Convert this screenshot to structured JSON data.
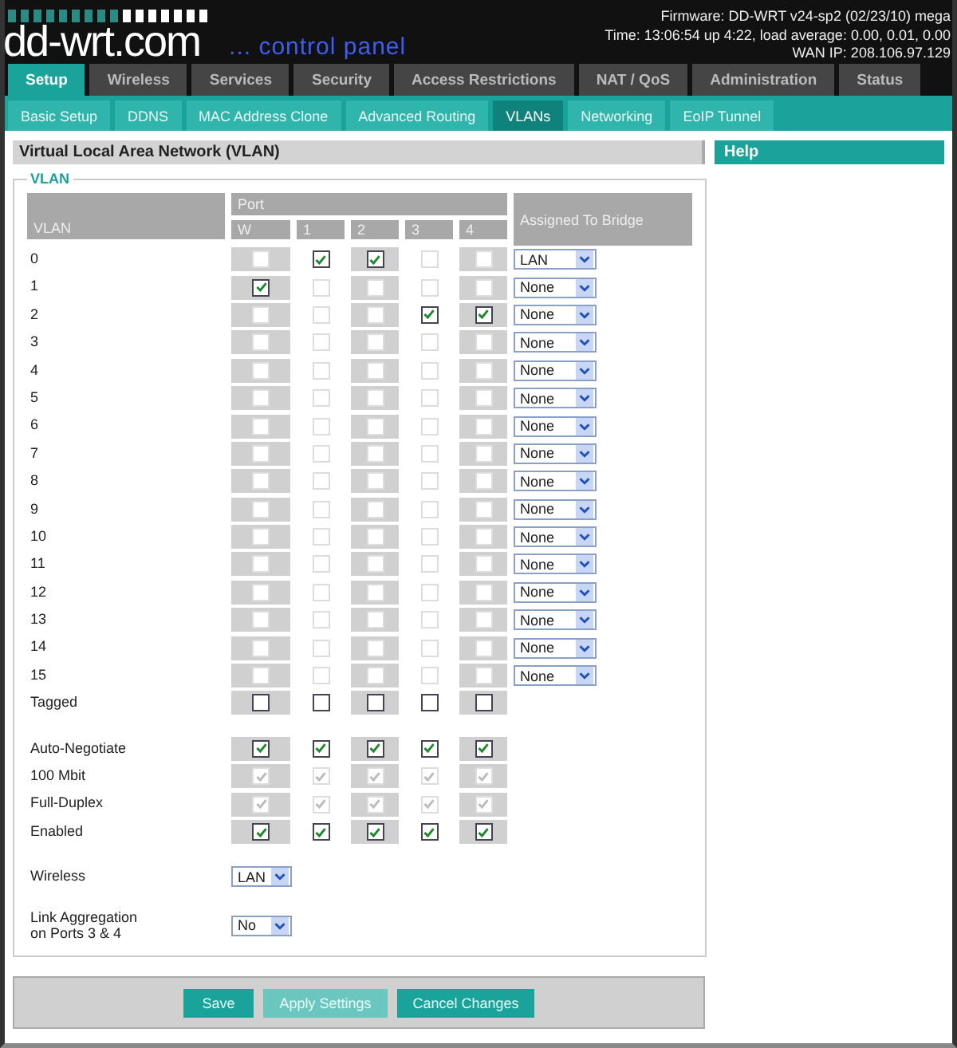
{
  "header": {
    "logo": "dd-wrt.com",
    "tagline": "... control panel",
    "info": [
      "Firmware: DD-WRT v24-sp2 (02/23/10) mega",
      "Time: 13:06:54 up 4:22, load average: 0.00, 0.01, 0.00",
      "WAN IP: 208.106.97.129"
    ]
  },
  "tabs": [
    {
      "label": "Setup",
      "selected": true
    },
    {
      "label": "Wireless",
      "selected": false
    },
    {
      "label": "Services",
      "selected": false
    },
    {
      "label": "Security",
      "selected": false
    },
    {
      "label": "Access Restrictions",
      "selected": false
    },
    {
      "label": "NAT / QoS",
      "selected": false
    },
    {
      "label": "Administration",
      "selected": false
    },
    {
      "label": "Status",
      "selected": false
    }
  ],
  "subtabs": [
    {
      "label": "Basic Setup",
      "selected": false
    },
    {
      "label": "DDNS",
      "selected": false
    },
    {
      "label": "MAC Address Clone",
      "selected": false
    },
    {
      "label": "Advanced Routing",
      "selected": false
    },
    {
      "label": "VLANs",
      "selected": true
    },
    {
      "label": "Networking",
      "selected": false
    },
    {
      "label": "EoIP Tunnel",
      "selected": false
    }
  ],
  "section_title": "Virtual Local Area Network (VLAN)",
  "help_title": "Help",
  "fieldset_legend": "VLAN",
  "columns": {
    "vlan": "VLAN",
    "port": "Port",
    "ports": [
      "W",
      "1",
      "2",
      "3",
      "4"
    ],
    "bridge": "Assigned To Bridge"
  },
  "vlans": [
    {
      "name": "0",
      "ports": [
        false,
        true,
        true,
        false,
        false
      ],
      "bridge": "LAN"
    },
    {
      "name": "1",
      "ports": [
        true,
        false,
        false,
        false,
        false
      ],
      "bridge": "None"
    },
    {
      "name": "2",
      "ports": [
        false,
        false,
        false,
        true,
        true
      ],
      "bridge": "None"
    },
    {
      "name": "3",
      "ports": [
        false,
        false,
        false,
        false,
        false
      ],
      "bridge": "None"
    },
    {
      "name": "4",
      "ports": [
        false,
        false,
        false,
        false,
        false
      ],
      "bridge": "None"
    },
    {
      "name": "5",
      "ports": [
        false,
        false,
        false,
        false,
        false
      ],
      "bridge": "None"
    },
    {
      "name": "6",
      "ports": [
        false,
        false,
        false,
        false,
        false
      ],
      "bridge": "None"
    },
    {
      "name": "7",
      "ports": [
        false,
        false,
        false,
        false,
        false
      ],
      "bridge": "None"
    },
    {
      "name": "8",
      "ports": [
        false,
        false,
        false,
        false,
        false
      ],
      "bridge": "None"
    },
    {
      "name": "9",
      "ports": [
        false,
        false,
        false,
        false,
        false
      ],
      "bridge": "None"
    },
    {
      "name": "10",
      "ports": [
        false,
        false,
        false,
        false,
        false
      ],
      "bridge": "None"
    },
    {
      "name": "11",
      "ports": [
        false,
        false,
        false,
        false,
        false
      ],
      "bridge": "None"
    },
    {
      "name": "12",
      "ports": [
        false,
        false,
        false,
        false,
        false
      ],
      "bridge": "None"
    },
    {
      "name": "13",
      "ports": [
        false,
        false,
        false,
        false,
        false
      ],
      "bridge": "None"
    },
    {
      "name": "14",
      "ports": [
        false,
        false,
        false,
        false,
        false
      ],
      "bridge": "None"
    },
    {
      "name": "15",
      "ports": [
        false,
        false,
        false,
        false,
        false
      ],
      "bridge": "None"
    }
  ],
  "tagged": {
    "label": "Tagged",
    "ports": [
      false,
      false,
      false,
      false,
      false
    ]
  },
  "port_settings": [
    {
      "label": "Auto-Negotiate",
      "disabled": false,
      "ports": [
        true,
        true,
        true,
        true,
        true
      ]
    },
    {
      "label": "100 Mbit",
      "disabled": true,
      "ports": [
        true,
        true,
        true,
        true,
        true
      ]
    },
    {
      "label": "Full-Duplex",
      "disabled": true,
      "ports": [
        true,
        true,
        true,
        true,
        true
      ]
    },
    {
      "label": "Enabled",
      "disabled": false,
      "ports": [
        true,
        true,
        true,
        true,
        true
      ]
    }
  ],
  "wireless": {
    "label": "Wireless",
    "value": "LAN"
  },
  "link_aggregation": {
    "label_lines": [
      "Link Aggregation",
      "on Ports 3 & 4"
    ],
    "value": "No"
  },
  "buttons": [
    {
      "label": "Save",
      "disabled": false
    },
    {
      "label": "Apply Settings",
      "disabled": true
    },
    {
      "label": "Cancel Changes",
      "disabled": false
    }
  ]
}
